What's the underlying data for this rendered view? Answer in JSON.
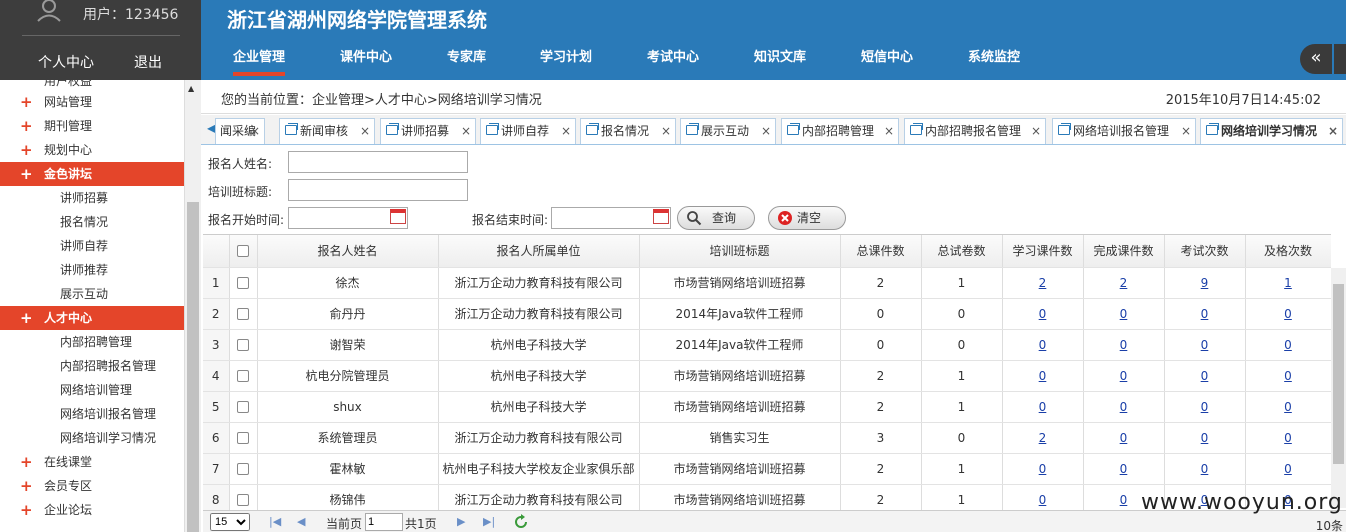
{
  "sidebar": {
    "user_label": "用户：123456",
    "links": [
      "个人中心",
      "退出"
    ],
    "cut_item": "用户权益",
    "menu": [
      {
        "label": "网站管理",
        "active": false
      },
      {
        "label": "期刊管理",
        "active": false
      },
      {
        "label": "规划中心",
        "active": false
      },
      {
        "label": "金色讲坛",
        "active": true
      },
      {
        "label": "人才中心",
        "active": true
      },
      {
        "label": "在线课堂",
        "active": false
      },
      {
        "label": "会员专区",
        "active": false
      },
      {
        "label": "企业论坛",
        "active": false
      }
    ],
    "sub_jinse": [
      "讲师招募",
      "报名情况",
      "讲师自荐",
      "讲师推荐",
      "展示互动"
    ],
    "sub_rencai": [
      "内部招聘管理",
      "内部招聘报名管理",
      "网络培训管理",
      "网络培训报名管理",
      "网络培训学习情况"
    ]
  },
  "header": {
    "title": "浙江省湖州网络学院管理系统",
    "nav": [
      "企业管理",
      "课件中心",
      "专家库",
      "学习计划",
      "考试中心",
      "知识文库",
      "短信中心",
      "系统监控"
    ],
    "collapse_glyph": "«"
  },
  "breadcrumb": {
    "path": "您的当前位置：企业管理>人才中心>网络培训学习情况",
    "datetime": "2015年10月7日14:45:02"
  },
  "tabs": {
    "scroll_left": "◀",
    "items": [
      "闻采编",
      "新闻审核",
      "讲师招募",
      "讲师自荐",
      "报名情况",
      "展示互动",
      "内部招聘管理",
      "内部招聘报名管理",
      "网络培训报名管理",
      "网络培训学习情况"
    ],
    "close": "×"
  },
  "form": {
    "name_label": "报名人姓名:",
    "class_label": "培训班标题:",
    "start_label": "报名开始时间:",
    "end_label": "报名结束时间:",
    "search_btn": "查询",
    "clear_btn": "清空"
  },
  "table": {
    "columns": [
      "报名人姓名",
      "报名人所属单位",
      "培训班标题",
      "总课件数",
      "总试卷数",
      "学习课件数",
      "完成课件数",
      "考试次数",
      "及格次数"
    ],
    "rows": [
      {
        "n": "1",
        "name": "徐杰",
        "unit": "浙江万企动力教育科技有限公司",
        "class": "市场营销网络培训班招募",
        "total_cw": "2",
        "total_paper": "1",
        "study": "2",
        "done": "2",
        "exam": "9",
        "pass": "1"
      },
      {
        "n": "2",
        "name": "俞丹丹",
        "unit": "浙江万企动力教育科技有限公司",
        "class": "2014年Java软件工程师",
        "total_cw": "0",
        "total_paper": "0",
        "study": "0",
        "done": "0",
        "exam": "0",
        "pass": "0"
      },
      {
        "n": "3",
        "name": "谢智荣",
        "unit": "杭州电子科技大学",
        "class": "2014年Java软件工程师",
        "total_cw": "0",
        "total_paper": "0",
        "study": "0",
        "done": "0",
        "exam": "0",
        "pass": "0"
      },
      {
        "n": "4",
        "name": "杭电分院管理员",
        "unit": "杭州电子科技大学",
        "class": "市场营销网络培训班招募",
        "total_cw": "2",
        "total_paper": "1",
        "study": "0",
        "done": "0",
        "exam": "0",
        "pass": "0"
      },
      {
        "n": "5",
        "name": "shux",
        "unit": "杭州电子科技大学",
        "class": "市场营销网络培训班招募",
        "total_cw": "2",
        "total_paper": "1",
        "study": "0",
        "done": "0",
        "exam": "0",
        "pass": "0"
      },
      {
        "n": "6",
        "name": "系统管理员",
        "unit": "浙江万企动力教育科技有限公司",
        "class": "销售实习生",
        "total_cw": "3",
        "total_paper": "0",
        "study": "2",
        "done": "0",
        "exam": "0",
        "pass": "0"
      },
      {
        "n": "7",
        "name": "霍林敏",
        "unit": "杭州电子科技大学校友企业家俱乐部",
        "class": "市场营销网络培训班招募",
        "total_cw": "2",
        "total_paper": "1",
        "study": "0",
        "done": "0",
        "exam": "0",
        "pass": "0"
      },
      {
        "n": "8",
        "name": "杨锦伟",
        "unit": "浙江万企动力教育科技有限公司",
        "class": "市场营销网络培训班招募",
        "total_cw": "2",
        "total_paper": "1",
        "study": "0",
        "done": "0",
        "exam": "0",
        "pass": "0"
      }
    ]
  },
  "pager": {
    "page_size": "15",
    "current_label": "当前页",
    "current_page": "1",
    "total_pages": "共1页",
    "total_records": "10条"
  },
  "watermark": "www.wooyun.org",
  "colors": {
    "header": "#2a7ab8",
    "accent": "#e4452a",
    "sidebar_dark": "#3d3d3d"
  }
}
